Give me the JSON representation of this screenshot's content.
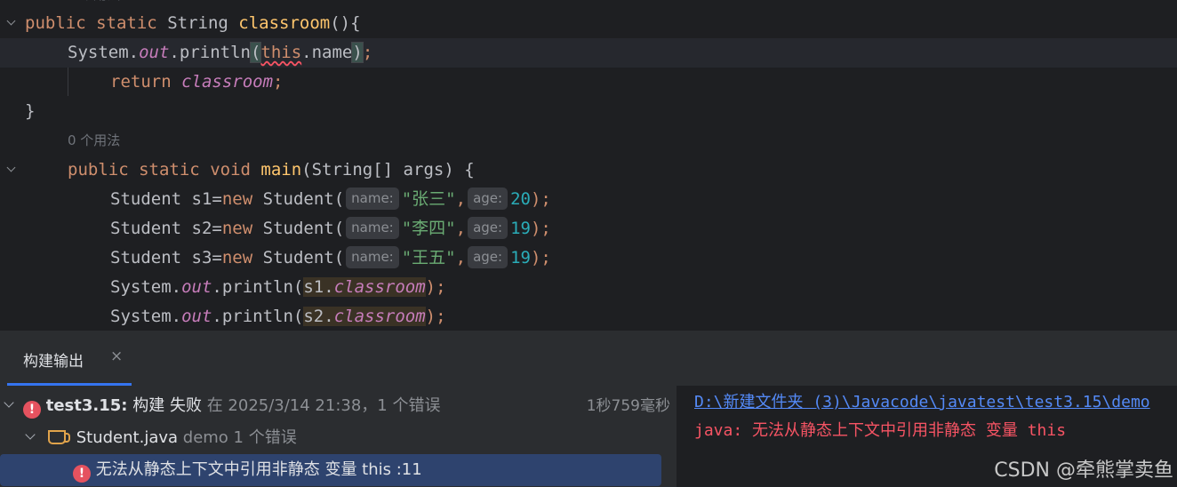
{
  "editor": {
    "top_hint": "0 个用法",
    "usage_hint": "0 个用法",
    "lines": {
      "l1": {
        "kw1": "public",
        "kw2": "static",
        "type": "String",
        "method": "classroom",
        "rest": "(){"
      },
      "l2": {
        "obj": "System",
        "field": "out",
        "call": "println",
        "open": "(",
        "kw": "this",
        "dot": ".name",
        "close": ")",
        "semi": ";"
      },
      "l3": {
        "kw": "return",
        "field": "classroom",
        "semi": ";"
      },
      "l4": {
        "text": "}"
      },
      "l6": {
        "kw1": "public",
        "kw2": "static",
        "kw3": "void",
        "method": "main",
        "rest": "(String[] args) {"
      },
      "students": [
        {
          "decl": "Student s1=",
          "kw": "new",
          "ctor": "Student(",
          "hint_name": "name:",
          "name": "\"张三\"",
          "comma": ",",
          "hint_age": "age:",
          "age": "20",
          "end": ");"
        },
        {
          "decl": "Student s2=",
          "kw": "new",
          "ctor": "Student(",
          "hint_name": "name:",
          "name": "\"李四\"",
          "comma": ",",
          "hint_age": "age:",
          "age": "19",
          "end": ");"
        },
        {
          "decl": "Student s3=",
          "kw": "new",
          "ctor": "Student(",
          "hint_name": "name:",
          "name": "\"王五\"",
          "comma": ",",
          "hint_age": "age:",
          "age": "19",
          "end": ");"
        }
      ],
      "prints": [
        {
          "obj": "System.",
          "field": "out",
          "call": ".println(",
          "var": "s1.",
          "member": "classroom",
          "end": ");"
        },
        {
          "obj": "System.",
          "field": "out",
          "call": ".println(",
          "var": "s2.",
          "member": "classroom",
          "end": ");"
        }
      ]
    }
  },
  "build": {
    "tab_label": "构建输出",
    "tab_close": "×",
    "root": {
      "name": "test3.15:",
      "status": "构建 失败",
      "detail": "在 2025/3/14 21:38，1 个错误",
      "duration": "1秒759毫秒"
    },
    "file": {
      "name": "Student.java",
      "module": "demo",
      "count": "1 个错误"
    },
    "error": {
      "message": "无法从静态上下文中引用非静态 变量 this :11"
    }
  },
  "console": {
    "path": "D:\\新建文件夹 (3)\\Javacode\\javatest\\test3.15\\demo",
    "err_prefix": "java:",
    "err_msg": "无法从静态上下文中引用非静态 变量",
    "err_kw": "this"
  },
  "watermark": "CSDN @牵熊掌卖鱼",
  "colors": {
    "accent": "#3574f0",
    "error": "#e5525f",
    "selection": "#2e436e"
  }
}
